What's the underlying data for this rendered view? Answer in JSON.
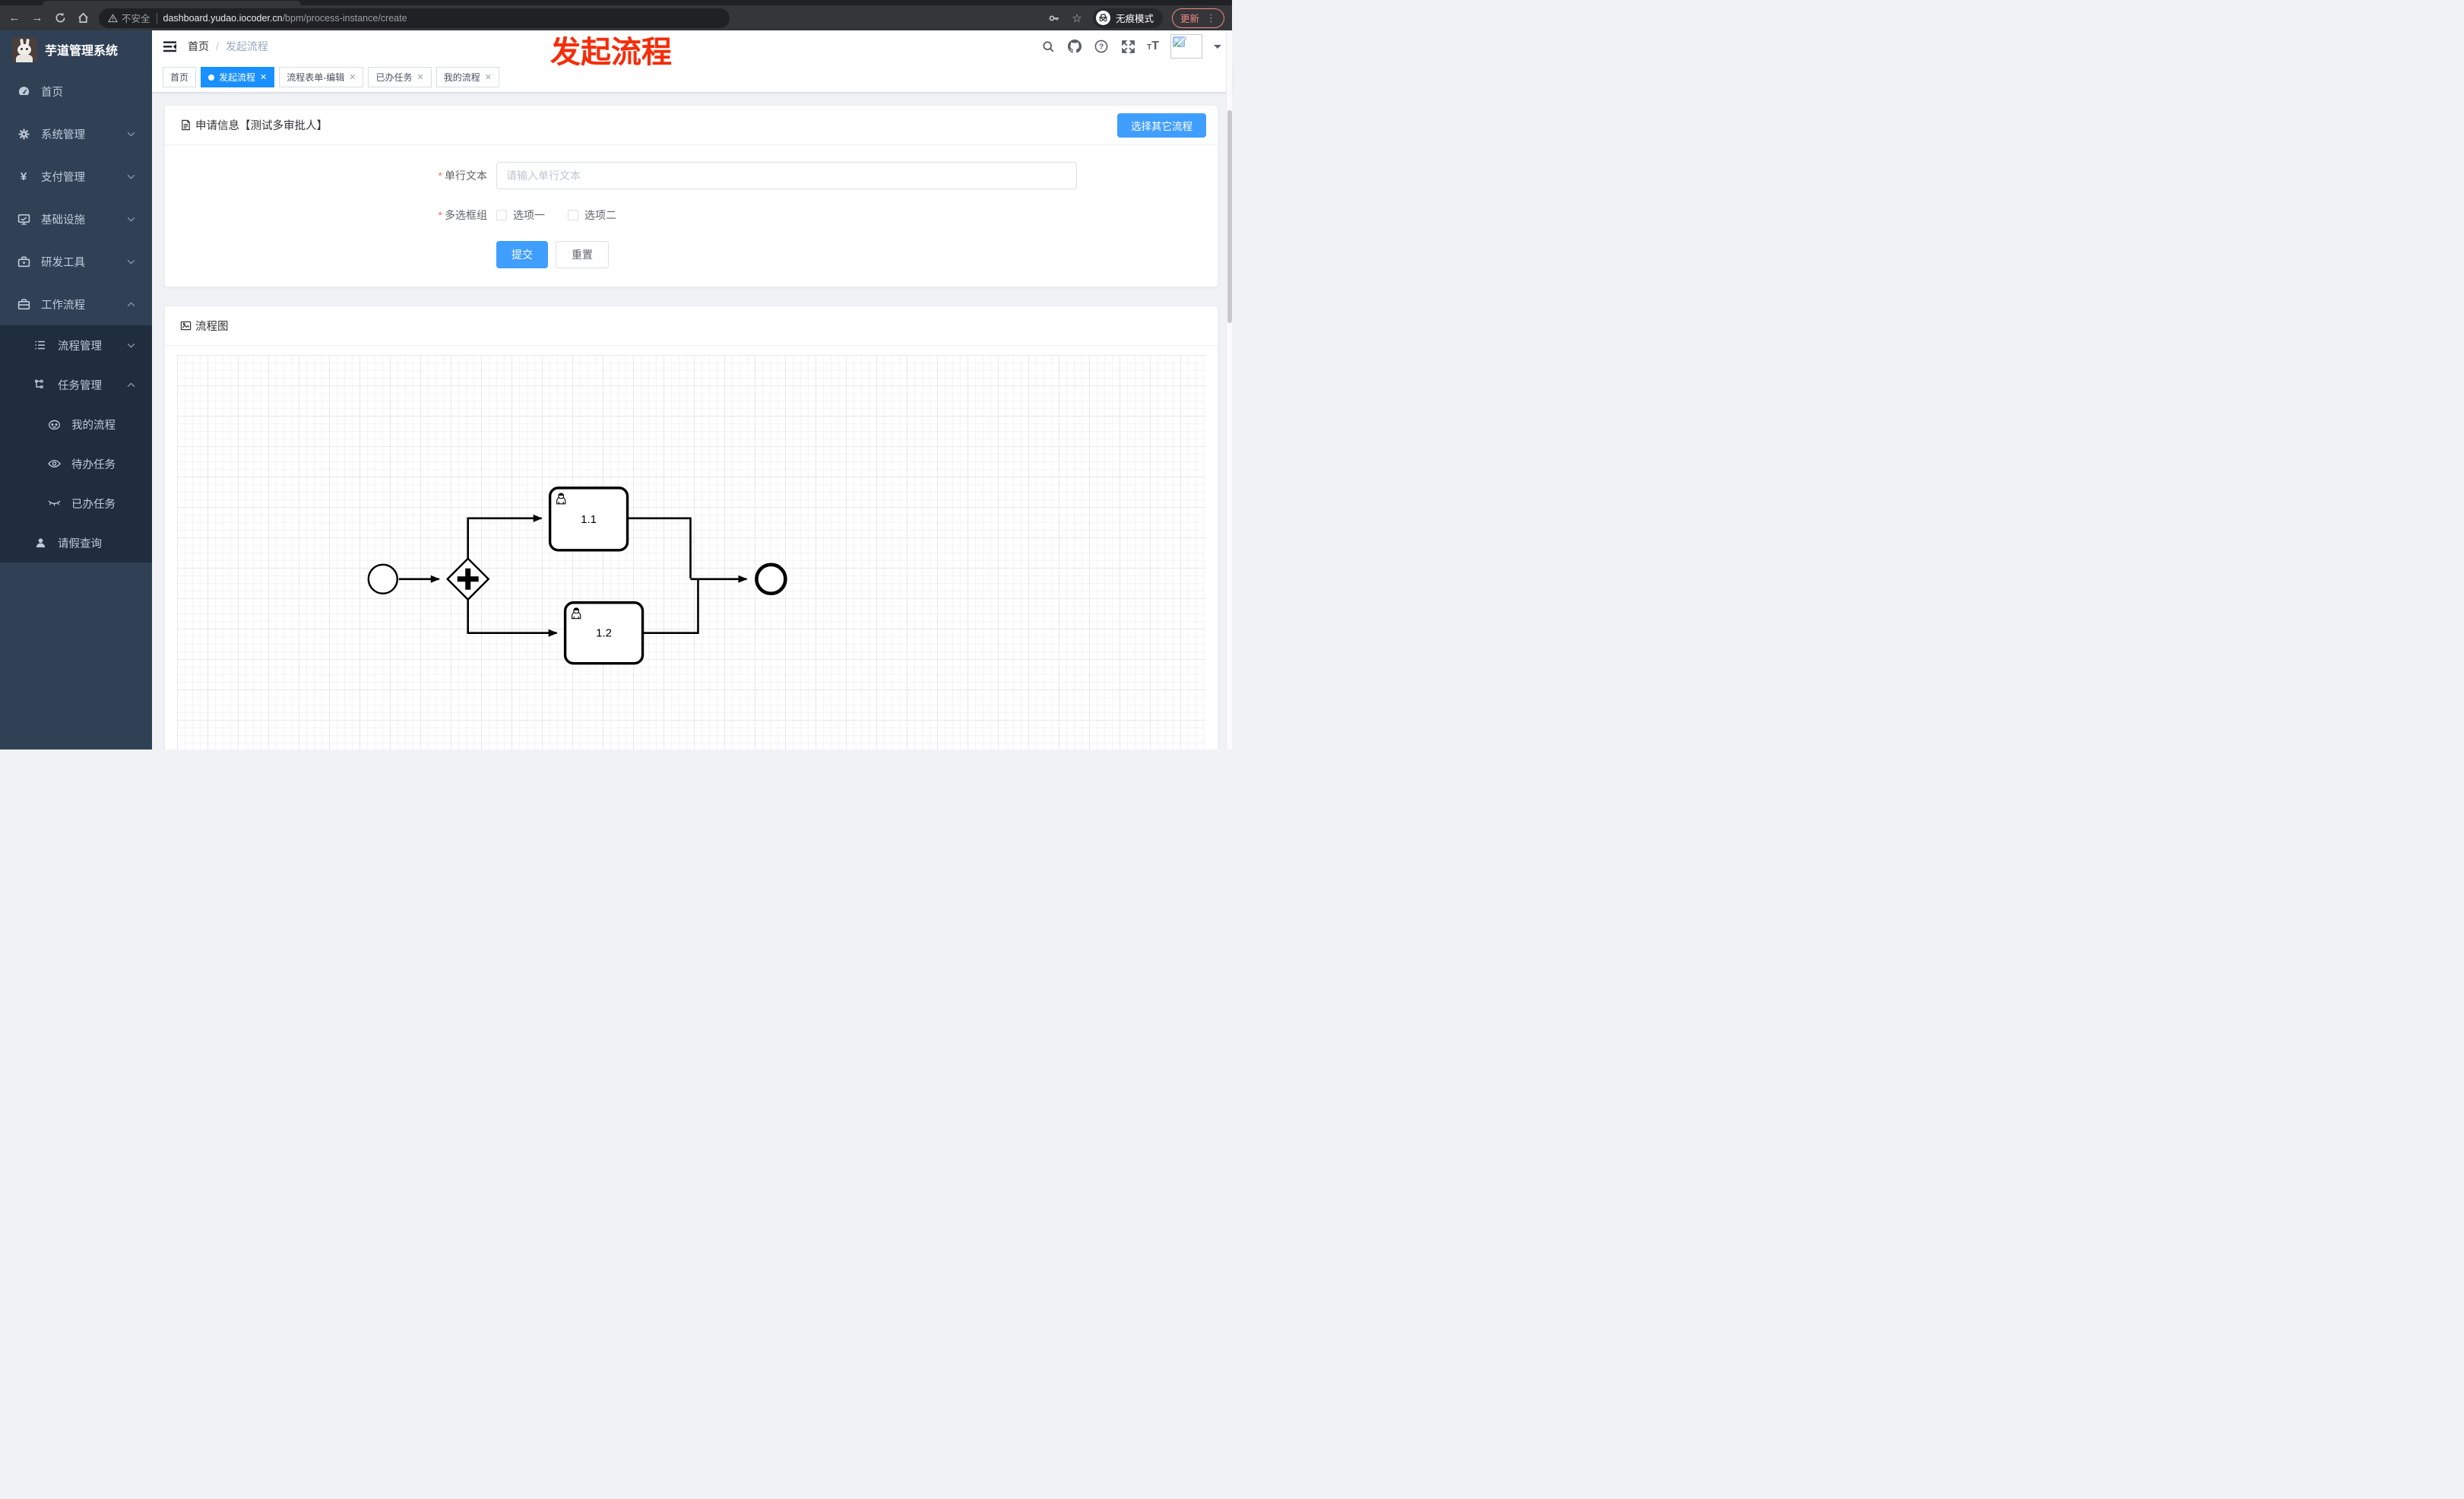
{
  "browser": {
    "security_label": "不安全",
    "url_host": "dashboard.yudao.iocoder.cn",
    "url_path": "/bpm/process-instance/create",
    "incognito_label": "无痕模式",
    "update_label": "更新",
    "menu_dots": "⋮"
  },
  "annotation": {
    "text": "发起流程",
    "color": "#f52d0a"
  },
  "sidebar": {
    "title": "芋道管理系统",
    "items": [
      {
        "label": "首页"
      },
      {
        "label": "系统管理"
      },
      {
        "label": "支付管理"
      },
      {
        "label": "基础设施"
      },
      {
        "label": "研发工具"
      },
      {
        "label": "工作流程"
      },
      {
        "label": "流程管理"
      },
      {
        "label": "任务管理"
      },
      {
        "label": "我的流程"
      },
      {
        "label": "待办任务"
      },
      {
        "label": "已办任务"
      },
      {
        "label": "请假查询"
      }
    ]
  },
  "header": {
    "breadcrumb_home": "首页",
    "breadcrumb_separator": "/",
    "breadcrumb_current": "发起流程"
  },
  "tabs": [
    {
      "label": "首页",
      "closable": false,
      "active": false
    },
    {
      "label": "发起流程",
      "closable": true,
      "active": true
    },
    {
      "label": "流程表单-编辑",
      "closable": true,
      "active": false
    },
    {
      "label": "已办任务",
      "closable": true,
      "active": false
    },
    {
      "label": "我的流程",
      "closable": true,
      "active": false
    }
  ],
  "form_card": {
    "title": "申请信息【测试多审批人】",
    "choose_other_button": "选择其它流程",
    "text_field": {
      "label": "单行文本",
      "placeholder": "请输入单行文本",
      "value": "",
      "required": true
    },
    "checkbox_group": {
      "label": "多选框组",
      "required": true,
      "options": [
        {
          "label": "选项一",
          "checked": false
        },
        {
          "label": "选项二",
          "checked": false
        }
      ]
    },
    "submit_button": "提交",
    "reset_button": "重置"
  },
  "diagram_card": {
    "title": "流程图",
    "bpmn": {
      "nodes": [
        {
          "id": "start",
          "type": "start-event"
        },
        {
          "id": "gateway",
          "type": "parallel-gateway"
        },
        {
          "id": "task-1-1",
          "type": "user-task",
          "label": "1.1"
        },
        {
          "id": "task-1-2",
          "type": "user-task",
          "label": "1.2"
        },
        {
          "id": "end",
          "type": "end-event"
        }
      ],
      "flows": [
        {
          "from": "start",
          "to": "gateway"
        },
        {
          "from": "gateway",
          "to": "task-1-1"
        },
        {
          "from": "gateway",
          "to": "task-1-2"
        },
        {
          "from": "task-1-1",
          "to": "end"
        },
        {
          "from": "task-1-2",
          "to": "end"
        }
      ]
    }
  },
  "colors": {
    "active_tab": "#1890ff",
    "primary_button": "#409eff",
    "sidebar_bg": "#304156",
    "sidebar_submenu_bg": "#1f2d3d",
    "annotation_red": "#f52d0a"
  }
}
